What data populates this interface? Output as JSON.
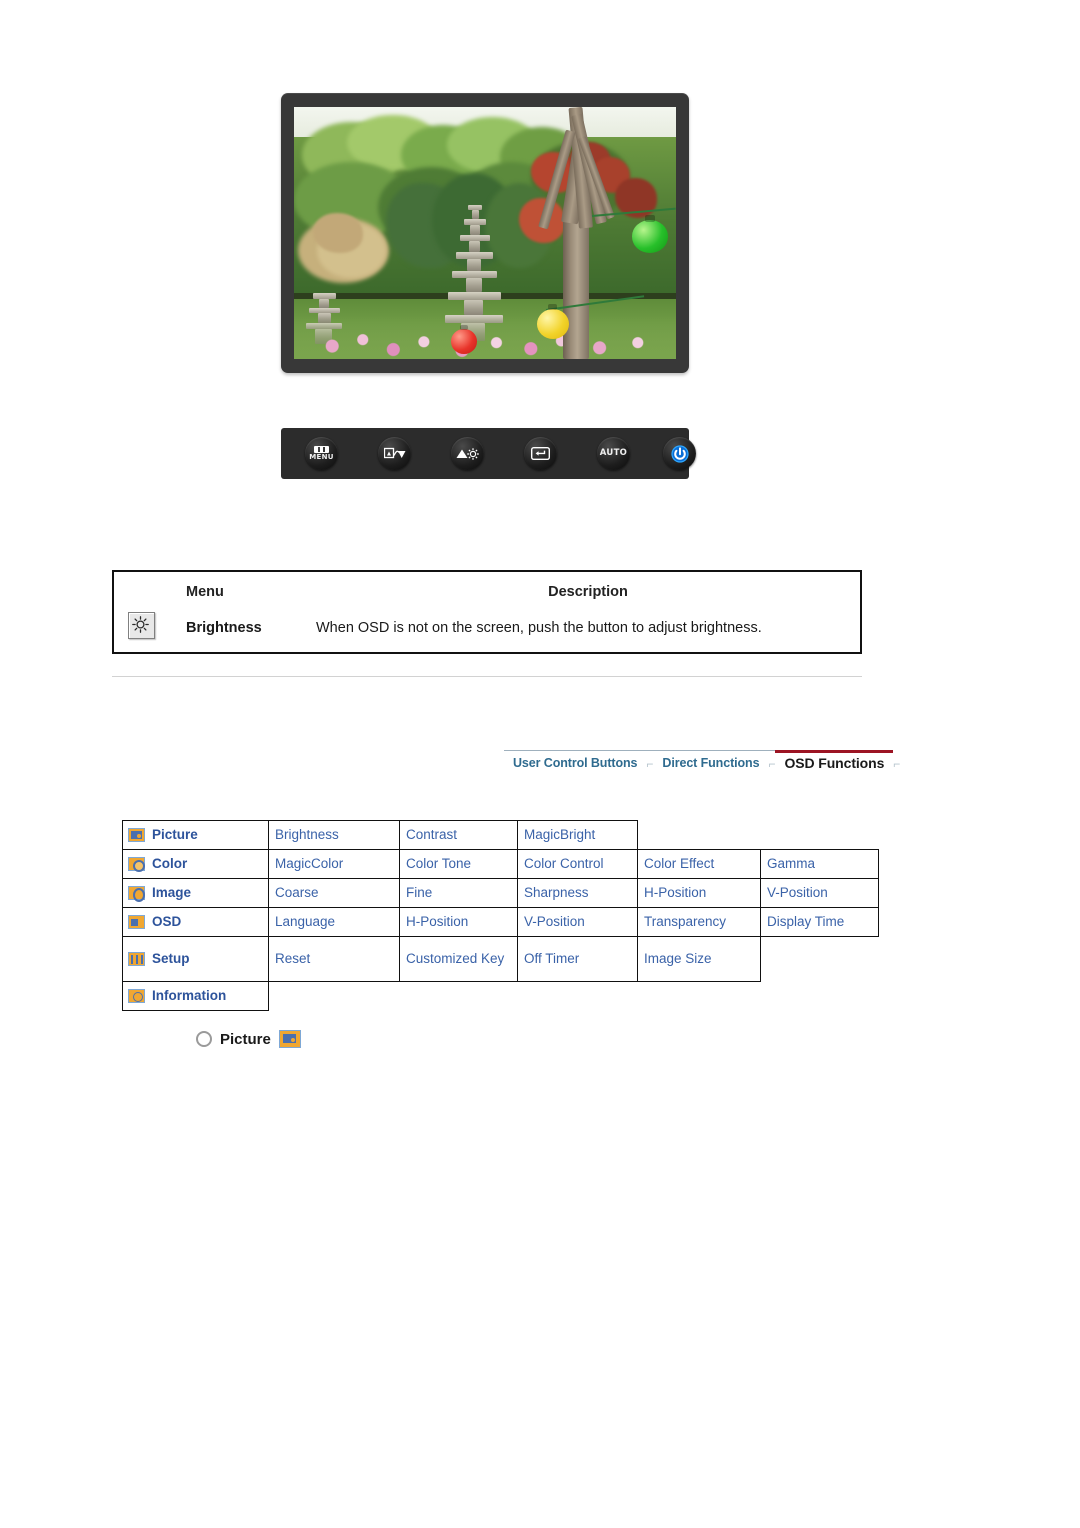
{
  "monitor": {
    "alt": "LCD monitor displaying a photo of a Korean garden with a stone pagoda, green trees, red maple foliage and colored paper lanterns",
    "buttons": [
      {
        "name": "menu-button",
        "label": "MENU",
        "glyph": "menu"
      },
      {
        "name": "source-down-button",
        "label": "",
        "glyph": "source-down"
      },
      {
        "name": "brightness-up-button",
        "label": "",
        "glyph": "brightness-up"
      },
      {
        "name": "enter-button",
        "label": "",
        "glyph": "enter"
      },
      {
        "name": "auto-button",
        "label": "AUTO",
        "glyph": "auto"
      },
      {
        "name": "power-button",
        "label": "",
        "glyph": "power"
      }
    ]
  },
  "description_table": {
    "headers": {
      "menu": "Menu",
      "description": "Description"
    },
    "rows": [
      {
        "icon": "brightness-icon",
        "menu": "Brightness",
        "description": "When OSD is not on the screen, push the button to adjust brightness."
      }
    ]
  },
  "tabs": {
    "separator": "⌐",
    "items": [
      {
        "label": "User Control Buttons",
        "active": false
      },
      {
        "label": "Direct Functions",
        "active": false
      },
      {
        "label": "OSD Functions",
        "active": true
      }
    ],
    "active_underline_color": "#9c1423",
    "link_color": "#2f6b8f"
  },
  "osd_matrix": {
    "rows": [
      {
        "category": "Picture",
        "icon": "picture-icon",
        "items": [
          "Brightness",
          "Contrast",
          "MagicBright"
        ],
        "trailing_blank": 2,
        "blank_style": "open"
      },
      {
        "category": "Color",
        "icon": "color-icon",
        "items": [
          "MagicColor",
          "Color Tone",
          "Color Control",
          "Color Effect",
          "Gamma"
        ],
        "trailing_blank": 0
      },
      {
        "category": "Image",
        "icon": "image-icon",
        "items": [
          "Coarse",
          "Fine",
          "Sharpness",
          "H-Position",
          "V-Position"
        ],
        "trailing_blank": 0
      },
      {
        "category": "OSD",
        "icon": "osd-icon",
        "items": [
          "Language",
          "H-Position",
          "V-Position",
          "Transparency",
          "Display Time"
        ],
        "trailing_blank": 0
      },
      {
        "category": "Setup",
        "icon": "setup-icon",
        "items": [
          "Reset",
          "Customized Key",
          "Off Timer",
          "Image Size"
        ],
        "trailing_blank": 1,
        "tall": true
      },
      {
        "category": "Information",
        "icon": "information-icon",
        "items": [],
        "trailing_blank": 5
      }
    ],
    "text_color": "#3a62a8",
    "border_color": "#111111"
  },
  "picture_section": {
    "bullet": "ring-bullet",
    "title": "Picture",
    "icon": "picture-icon"
  }
}
